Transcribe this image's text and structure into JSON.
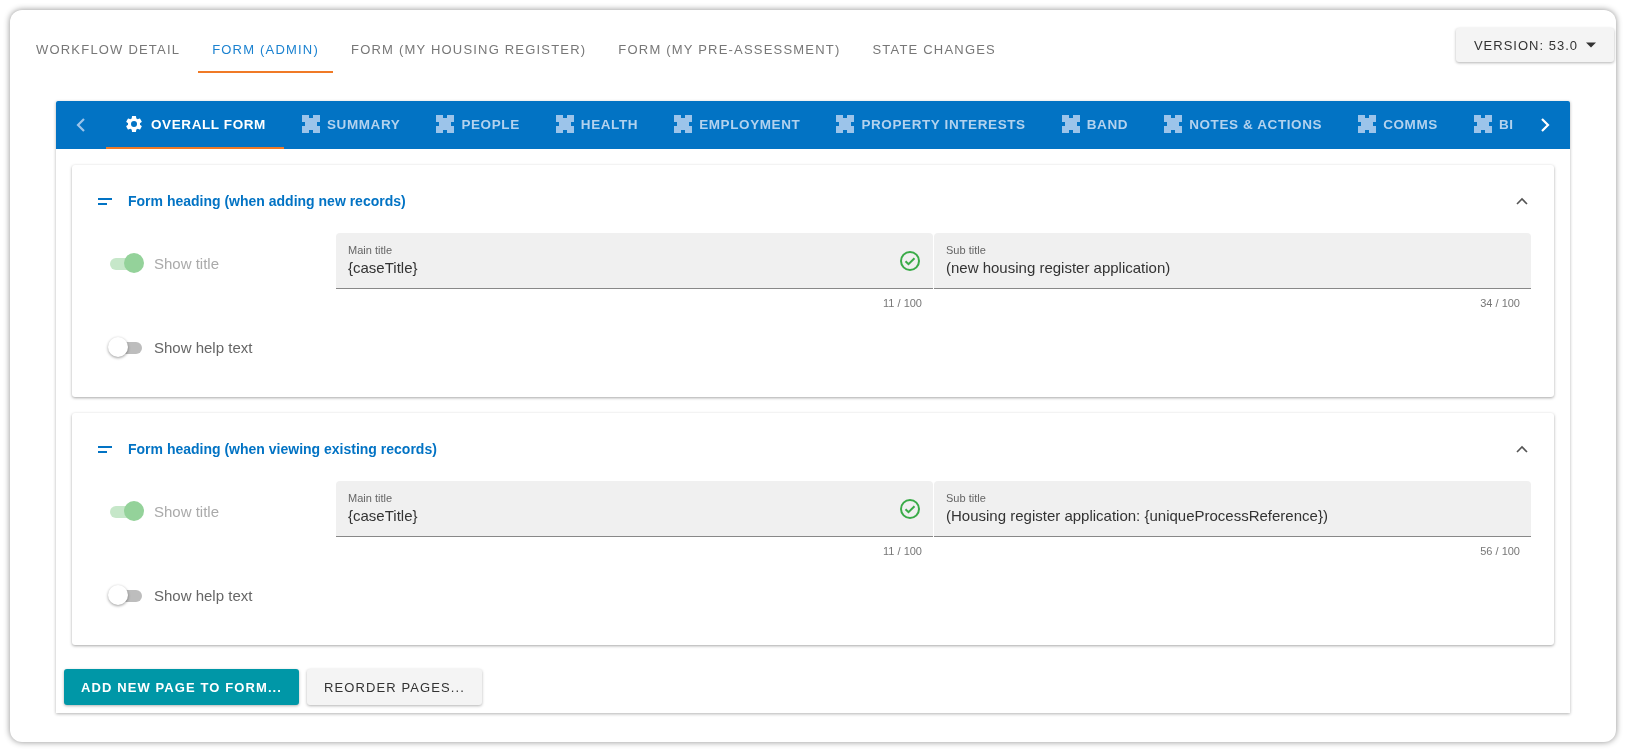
{
  "top_tabs": [
    {
      "label": "WORKFLOW DETAIL",
      "selected": false
    },
    {
      "label": "FORM (ADMIN)",
      "selected": true
    },
    {
      "label": "FORM (MY HOUSING REGISTER)",
      "selected": false
    },
    {
      "label": "FORM (MY PRE-ASSESSMENT)",
      "selected": false
    },
    {
      "label": "STATE CHANGES",
      "selected": false
    }
  ],
  "version_button": "VERSION: 53.0",
  "page_tabs": [
    {
      "label": "OVERALL FORM",
      "kind": "settings",
      "selected": true
    },
    {
      "label": "SUMMARY",
      "kind": "page",
      "selected": false
    },
    {
      "label": "PEOPLE",
      "kind": "page",
      "selected": false
    },
    {
      "label": "HEALTH",
      "kind": "page",
      "selected": false
    },
    {
      "label": "EMPLOYMENT",
      "kind": "page",
      "selected": false
    },
    {
      "label": "PROPERTY INTERESTS",
      "kind": "page",
      "selected": false
    },
    {
      "label": "BAND",
      "kind": "page",
      "selected": false
    },
    {
      "label": "NOTES & ACTIONS",
      "kind": "page",
      "selected": false
    },
    {
      "label": "COMMS",
      "kind": "page",
      "selected": false
    },
    {
      "label": "BI",
      "kind": "page",
      "selected": false
    }
  ],
  "sections": [
    {
      "title": "Form heading (when adding new records)",
      "expanded": true,
      "show_title": {
        "label": "Show title",
        "on": true,
        "disabled": true
      },
      "show_help_text": {
        "label": "Show help text",
        "on": false
      },
      "main_title": {
        "label": "Main title",
        "value": "{caseTitle}",
        "counter": "11 / 100",
        "valid": true
      },
      "sub_title": {
        "label": "Sub title",
        "value": "(new housing register application)",
        "counter": "34 / 100",
        "valid": false
      }
    },
    {
      "title": "Form heading (when viewing existing records)",
      "expanded": true,
      "show_title": {
        "label": "Show title",
        "on": true,
        "disabled": true
      },
      "show_help_text": {
        "label": "Show help text",
        "on": false
      },
      "main_title": {
        "label": "Main title",
        "value": "{caseTitle}",
        "counter": "11 / 100",
        "valid": true
      },
      "sub_title": {
        "label": "Sub title",
        "value": "(Housing register application: {uniqueProcessReference})",
        "counter": "56 / 100",
        "valid": false
      }
    }
  ],
  "buttons": [
    {
      "label": "ADD NEW PAGE TO FORM...",
      "kind": "primary"
    },
    {
      "label": "REORDER PAGES...",
      "kind": "secondary"
    }
  ]
}
